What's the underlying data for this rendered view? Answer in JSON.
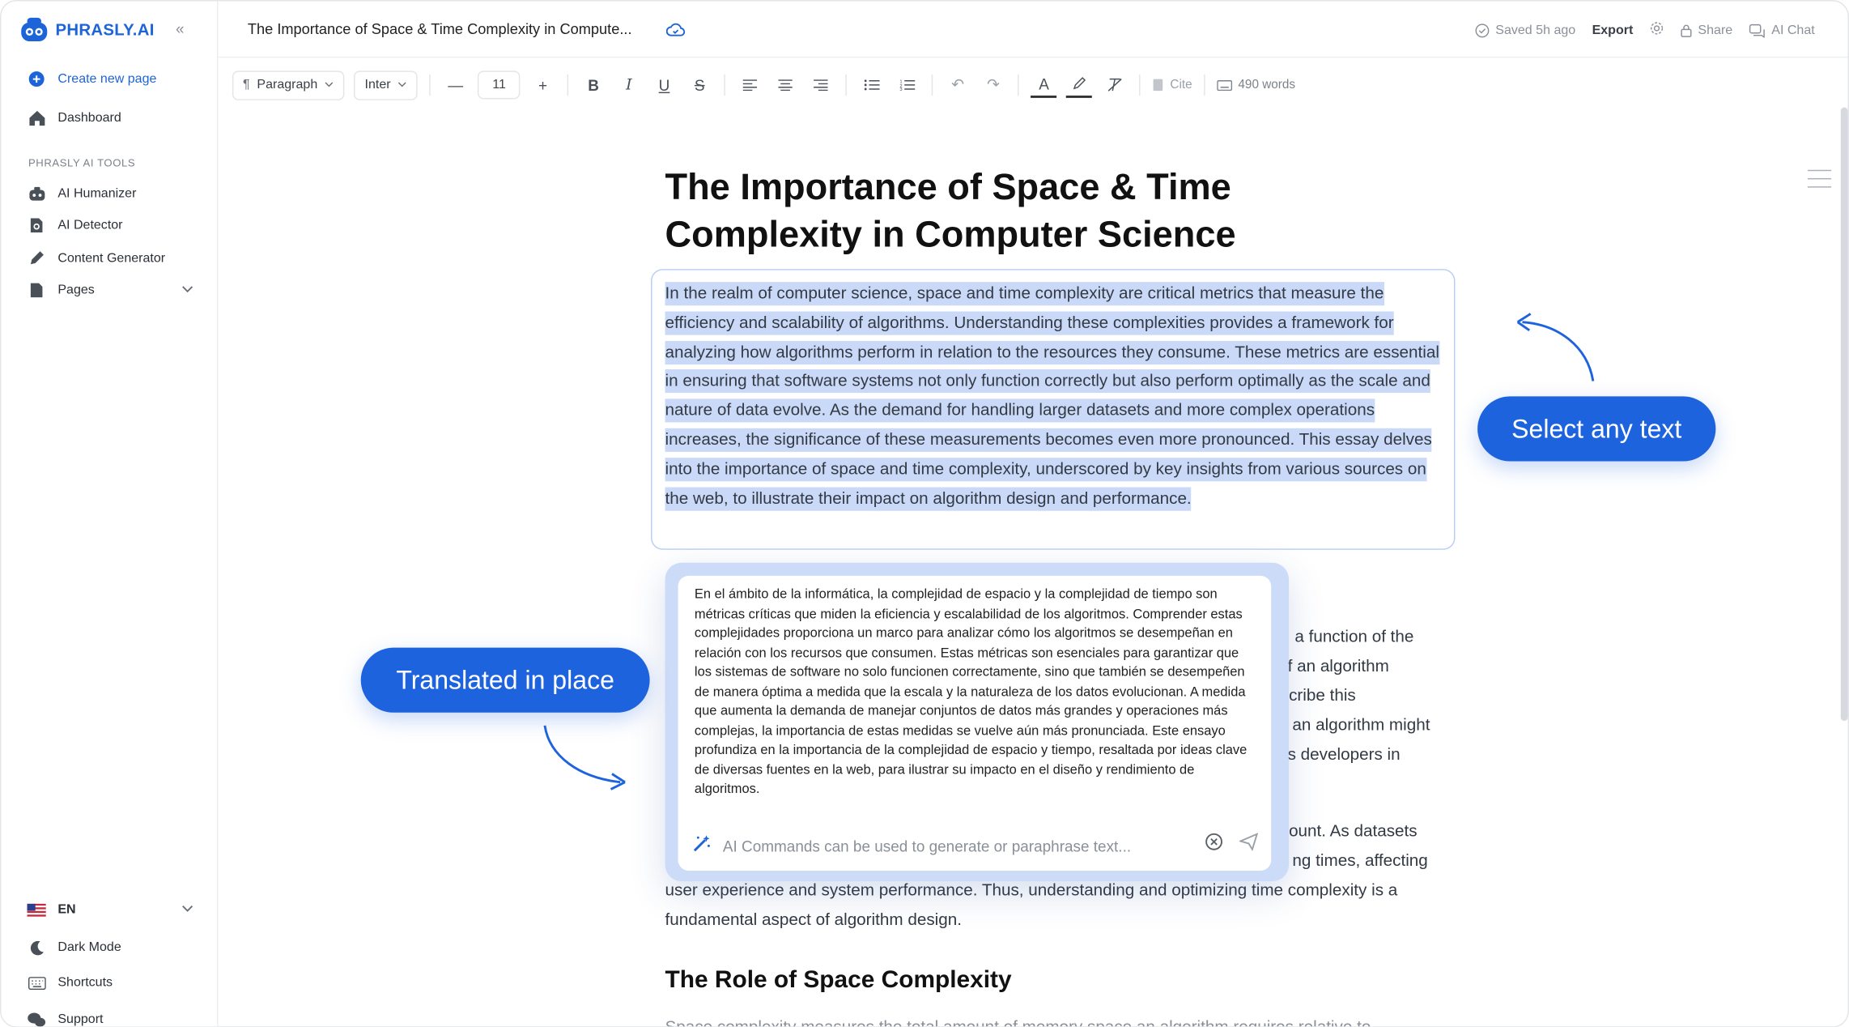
{
  "app": {
    "logo_text": "PHRASLY.AI",
    "brand_color": "#1d64d8"
  },
  "sidebar": {
    "create_label": "Create new page",
    "dashboard_label": "Dashboard",
    "section_label": "PHRASLY AI TOOLS",
    "tools": [
      {
        "label": "AI Humanizer",
        "icon": "robot-icon"
      },
      {
        "label": "AI Detector",
        "icon": "document-search-icon"
      },
      {
        "label": "Content Generator",
        "icon": "pencil-icon"
      },
      {
        "label": "Pages",
        "icon": "page-icon"
      }
    ],
    "language": "EN",
    "dark_mode_label": "Dark Mode",
    "shortcuts_label": "Shortcuts",
    "support_label": "Support"
  },
  "topbar": {
    "doc_title": "The Importance of Space & Time Complexity in Compute...",
    "saved_status": "Saved 5h ago",
    "export_label": "Export",
    "share_label": "Share",
    "ai_chat_label": "AI Chat"
  },
  "toolbar": {
    "block_type": "Paragraph",
    "font": "Inter",
    "font_size": "11",
    "cite_label": "Cite",
    "word_count": "490 words"
  },
  "document": {
    "title": "The Importance of Space & Time Complexity in Computer Science",
    "selected_paragraph": "In the realm of computer science, space and time complexity are critical metrics that measure the efficiency and scalability of algorithms. Understanding these complexities provides a framework for analyzing how algorithms perform in relation to the resources they consume. These metrics are essential in ensuring that software systems not only function correctly but also perform optimally as the scale and nature of data evolve. As the demand for handling larger datasets and more complex operations increases, the significance of these measurements becomes even more pronounced. This essay delves into the importance of space and time complexity, underscored by key insights from various sources on the web, to illustrate their impact on algorithm design and performance.",
    "partial_lines": [
      "a function of the",
      "f an algorithm",
      "cribe this",
      "an algorithm might",
      "s developers in",
      "ount. As datasets",
      "ng times, affecting"
    ],
    "paragraph_tail": "user experience and system performance. Thus, understanding and optimizing time complexity is a fundamental aspect of algorithm design.",
    "heading_2": "The Role of Space Complexity",
    "cutoff_line": "Space complexity measures the total amount of memory space an algorithm requires relative to"
  },
  "popup": {
    "translation": "En el ámbito de la informática, la complejidad de espacio y la complejidad de tiempo son métricas críticas que miden la eficiencia y escalabilidad de los algoritmos. Comprender estas complejidades proporciona un marco para analizar cómo los algoritmos se desempeñan en relación con los recursos que consumen. Estas métricas son esenciales para garantizar que los sistemas de software no solo funcionen correctamente, sino que también se desempeñen de manera óptima a medida que la escala y la naturaleza de los datos evolucionan. A medida que aumenta la demanda de manejar conjuntos de datos más grandes y operaciones más complejas, la importancia de estas medidas se vuelve aún más pronunciada. Este ensayo profundiza en la importancia de la complejidad de espacio y tiempo, resaltada por ideas clave de diversas fuentes en la web, para ilustrar su impacto en el diseño y rendimiento de algoritmos.",
    "command_placeholder": "AI Commands can be used to generate or paraphrase text..."
  },
  "callouts": {
    "select": "Select any text",
    "translated": "Translated in place",
    "color": "#1e63de"
  }
}
